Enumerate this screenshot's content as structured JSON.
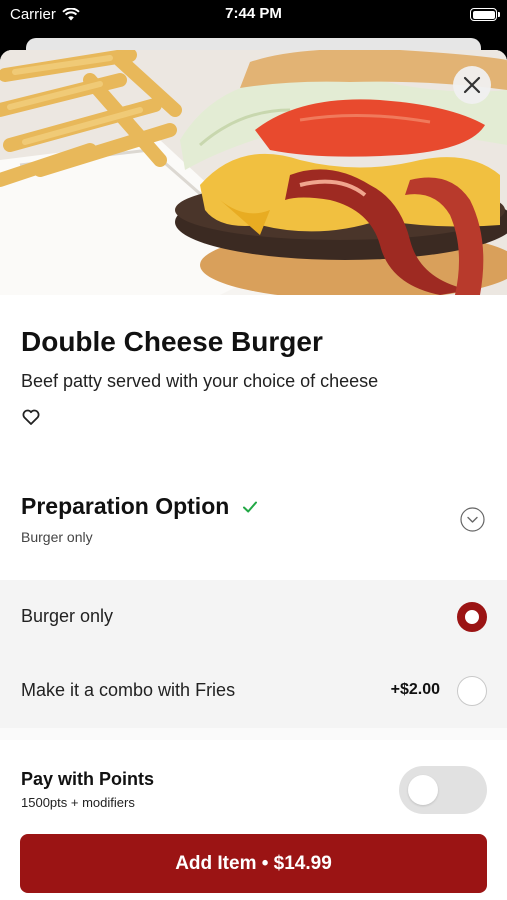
{
  "status_bar": {
    "carrier": "Carrier",
    "time": "7:44 PM"
  },
  "item": {
    "name": "Double Cheese Burger",
    "description": "Beef patty served with your choice of cheese"
  },
  "preparation": {
    "title": "Preparation Option",
    "selected_summary": "Burger only",
    "options": [
      {
        "label": "Burger only",
        "price": "",
        "selected": true
      },
      {
        "label": "Make it a combo with Fries",
        "price": "+$2.00",
        "selected": false
      }
    ]
  },
  "points": {
    "title": "Pay with Points",
    "subtitle": "1500pts + modifiers",
    "enabled": false
  },
  "add_button": {
    "label": "Add Item • $14.99"
  },
  "colors": {
    "accent": "#9b1414",
    "check": "#22a845",
    "options_bg": "#f4f4f4"
  },
  "icons": [
    "wifi-icon",
    "battery-icon",
    "close-icon",
    "heart-icon",
    "check-icon",
    "chevron-down-icon"
  ]
}
